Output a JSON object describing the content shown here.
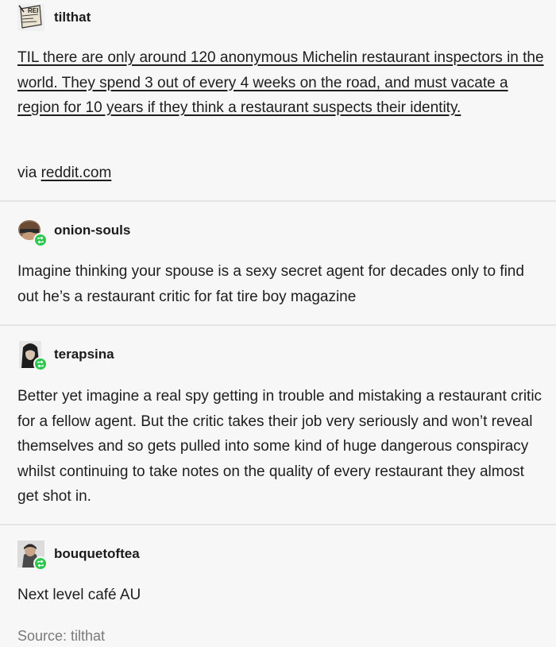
{
  "posts": [
    {
      "username": "tilthat",
      "avatar_icon": "newspaper-avatar-icon",
      "body": "TIL there are only around 120 anonymous Michelin restaurant inspectors in the world. They spend 3 out of every 4 weeks on the road, and must vacate a region for 10 years if they think a restaurant suspects their identity.",
      "via_prefix": "via",
      "via_link": "reddit.com"
    },
    {
      "username": "onion-souls",
      "avatar_icon": "character-avatar-icon",
      "body": "Imagine thinking your spouse is a sexy secret agent for decades only to find out he’s a restaurant critic for fat tire boy magazine"
    },
    {
      "username": "terapsina",
      "avatar_icon": "portrait-avatar-icon",
      "body": "Better yet imagine a real spy getting in trouble and mistaking a restaurant critic for a fellow agent. But the critic takes their job very seriously and won’t reveal themselves and so gets pulled into some kind of huge dangerous conspiracy whilst continuing to take notes on the quality of every restaurant they almost get shot in."
    },
    {
      "username": "bouquetoftea",
      "avatar_icon": "person-avatar-icon",
      "body": "Next level café AU"
    }
  ],
  "source": "Source: tilthat",
  "colors": {
    "background": "#f7f7f7",
    "reblog_badge": "#2cc84d",
    "divider": "#e4e4e4"
  }
}
